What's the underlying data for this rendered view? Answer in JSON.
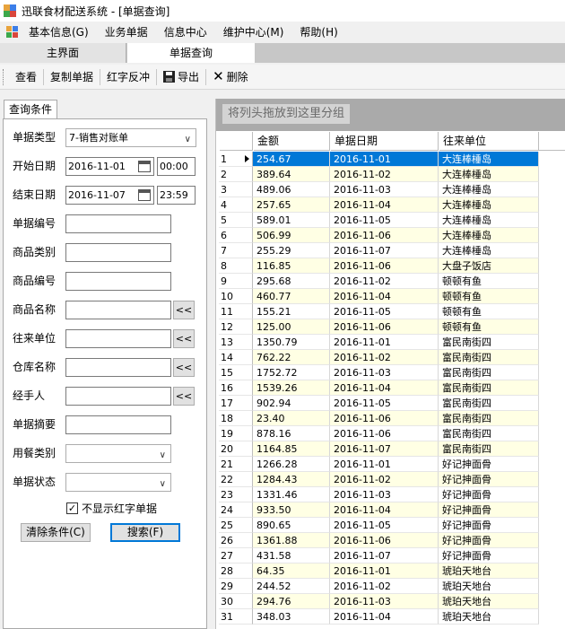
{
  "window": {
    "title": "迅联食材配送系统 - [单据查询]"
  },
  "menu": {
    "items": [
      {
        "label": "基本信息(G)"
      },
      {
        "label": "业务单据"
      },
      {
        "label": "信息中心"
      },
      {
        "label": "维护中心(M)"
      },
      {
        "label": "帮助(H)"
      }
    ]
  },
  "doc_tabs": {
    "main": "主界面",
    "active": "单据查询"
  },
  "toolbar": {
    "view": "查看",
    "copy": "复制单据",
    "reverse": "红字反冲",
    "export": "导出",
    "delete": "删除"
  },
  "query_panel": {
    "tab_label": "查询条件",
    "labels": {
      "doc_type": "单据类型",
      "start_date": "开始日期",
      "end_date": "结束日期",
      "doc_no": "单据编号",
      "category": "商品类别",
      "goods_no": "商品编号",
      "goods_name": "商品名称",
      "partner": "往来单位",
      "warehouse": "仓库名称",
      "handler": "经手人",
      "summary": "单据摘要",
      "meal_type": "用餐类别",
      "status": "单据状态"
    },
    "doc_type_value": "7-销售对账单",
    "start_date_value": "2016-11-01",
    "start_time_value": "00:00",
    "end_date_value": "2016-11-07",
    "end_time_value": "23:59",
    "picker_label": "<<",
    "hide_red_label": "不显示红字单据",
    "hide_red_checked": "✓",
    "clear_button": "清除条件(C)",
    "search_button": "搜索(F)"
  },
  "grid": {
    "group_hint": "将列头拖放到这里分组",
    "columns": [
      "金额",
      "单据日期",
      "往来单位"
    ],
    "rows": [
      {
        "n": "1",
        "amount": "254.67",
        "date": "2016-11-01",
        "partner": "大连棒棰岛"
      },
      {
        "n": "2",
        "amount": "389.64",
        "date": "2016-11-02",
        "partner": "大连棒棰岛"
      },
      {
        "n": "3",
        "amount": "489.06",
        "date": "2016-11-03",
        "partner": "大连棒棰岛"
      },
      {
        "n": "4",
        "amount": "257.65",
        "date": "2016-11-04",
        "partner": "大连棒棰岛"
      },
      {
        "n": "5",
        "amount": "589.01",
        "date": "2016-11-05",
        "partner": "大连棒棰岛"
      },
      {
        "n": "6",
        "amount": "506.99",
        "date": "2016-11-06",
        "partner": "大连棒棰岛"
      },
      {
        "n": "7",
        "amount": "255.29",
        "date": "2016-11-07",
        "partner": "大连棒棰岛"
      },
      {
        "n": "8",
        "amount": "116.85",
        "date": "2016-11-06",
        "partner": "大盘子饭店"
      },
      {
        "n": "9",
        "amount": "295.68",
        "date": "2016-11-02",
        "partner": "顿顿有鱼"
      },
      {
        "n": "10",
        "amount": "460.77",
        "date": "2016-11-04",
        "partner": "顿顿有鱼"
      },
      {
        "n": "11",
        "amount": "155.21",
        "date": "2016-11-05",
        "partner": "顿顿有鱼"
      },
      {
        "n": "12",
        "amount": "125.00",
        "date": "2016-11-06",
        "partner": "顿顿有鱼"
      },
      {
        "n": "13",
        "amount": "1350.79",
        "date": "2016-11-01",
        "partner": "富民南街四"
      },
      {
        "n": "14",
        "amount": "762.22",
        "date": "2016-11-02",
        "partner": "富民南街四"
      },
      {
        "n": "15",
        "amount": "1752.72",
        "date": "2016-11-03",
        "partner": "富民南街四"
      },
      {
        "n": "16",
        "amount": "1539.26",
        "date": "2016-11-04",
        "partner": "富民南街四"
      },
      {
        "n": "17",
        "amount": "902.94",
        "date": "2016-11-05",
        "partner": "富民南街四"
      },
      {
        "n": "18",
        "amount": "23.40",
        "date": "2016-11-06",
        "partner": "富民南街四"
      },
      {
        "n": "19",
        "amount": "878.16",
        "date": "2016-11-06",
        "partner": "富民南街四"
      },
      {
        "n": "20",
        "amount": "1164.85",
        "date": "2016-11-07",
        "partner": "富民南街四"
      },
      {
        "n": "21",
        "amount": "1266.28",
        "date": "2016-11-01",
        "partner": "好记抻面骨"
      },
      {
        "n": "22",
        "amount": "1284.43",
        "date": "2016-11-02",
        "partner": "好记抻面骨"
      },
      {
        "n": "23",
        "amount": "1331.46",
        "date": "2016-11-03",
        "partner": "好记抻面骨"
      },
      {
        "n": "24",
        "amount": "933.50",
        "date": "2016-11-04",
        "partner": "好记抻面骨"
      },
      {
        "n": "25",
        "amount": "890.65",
        "date": "2016-11-05",
        "partner": "好记抻面骨"
      },
      {
        "n": "26",
        "amount": "1361.88",
        "date": "2016-11-06",
        "partner": "好记抻面骨"
      },
      {
        "n": "27",
        "amount": "431.58",
        "date": "2016-11-07",
        "partner": "好记抻面骨"
      },
      {
        "n": "28",
        "amount": "64.35",
        "date": "2016-11-01",
        "partner": "琥珀天地台"
      },
      {
        "n": "29",
        "amount": "244.52",
        "date": "2016-11-02",
        "partner": "琥珀天地台"
      },
      {
        "n": "30",
        "amount": "294.76",
        "date": "2016-11-03",
        "partner": "琥珀天地台"
      },
      {
        "n": "31",
        "amount": "348.03",
        "date": "2016-11-04",
        "partner": "琥珀天地台"
      }
    ],
    "selected_row": 1
  },
  "colors": {
    "selection": "#0078d7",
    "alt_row": "#ffffe4",
    "group_area": "#aaaaaa"
  }
}
